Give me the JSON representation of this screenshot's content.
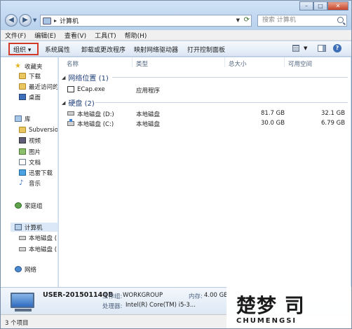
{
  "window": {
    "address": "计算机",
    "search_placeholder": "搜索 计算机",
    "controls": {
      "minimize": "–",
      "maximize": "□",
      "close": "✕"
    }
  },
  "menu": [
    "文件(F)",
    "编辑(E)",
    "查看(V)",
    "工具(T)",
    "帮助(H)"
  ],
  "toolbar": {
    "organize": "组织 ▾",
    "system_properties": "系统属性",
    "uninstall": "卸载或更改程序",
    "map_drive": "映射网络驱动器",
    "control_panel": "打开控制面板"
  },
  "nav": {
    "favorites": "收藏夹",
    "downloads": "下载",
    "recent": "最近访问的",
    "desktop": "桌面",
    "libraries": "库",
    "subversion": "Subversion",
    "videos": "视频",
    "pictures": "图片",
    "documents": "文档",
    "thunder": "迅雷下载",
    "music": "音乐",
    "homegroup": "家庭组",
    "computer": "计算机",
    "drive_d": "本地磁盘 (",
    "drive_c": "本地磁盘 (",
    "network": "网络"
  },
  "columns": {
    "name": "名称",
    "type": "类型",
    "total": "总大小",
    "free": "可用空间"
  },
  "groups": {
    "network": "网络位置 (1)",
    "disks": "硬盘 (2)"
  },
  "items": {
    "ecap": {
      "name": "ECap.exe",
      "type": "应用程序"
    },
    "drive_d": {
      "name": "本地磁盘 (D:)",
      "type": "本地磁盘",
      "total": "81.7 GB",
      "free": "32.1 GB"
    },
    "drive_c": {
      "name": "本地磁盘 (C:)",
      "type": "本地磁盘",
      "total": "30.0 GB",
      "free": "6.79 GB"
    }
  },
  "details": {
    "name": "USER-20150114QB",
    "workgroup_label": "工作组:",
    "workgroup": "WORKGROUP",
    "memory_label": "内存:",
    "memory": "4.00 GB",
    "cpu_label": "处理器:",
    "cpu": "Intel(R) Core(TM) i5-3..."
  },
  "status": "3 个项目",
  "watermark": {
    "logo": "楚梦 司",
    "sub": "CHUMENGSI"
  }
}
